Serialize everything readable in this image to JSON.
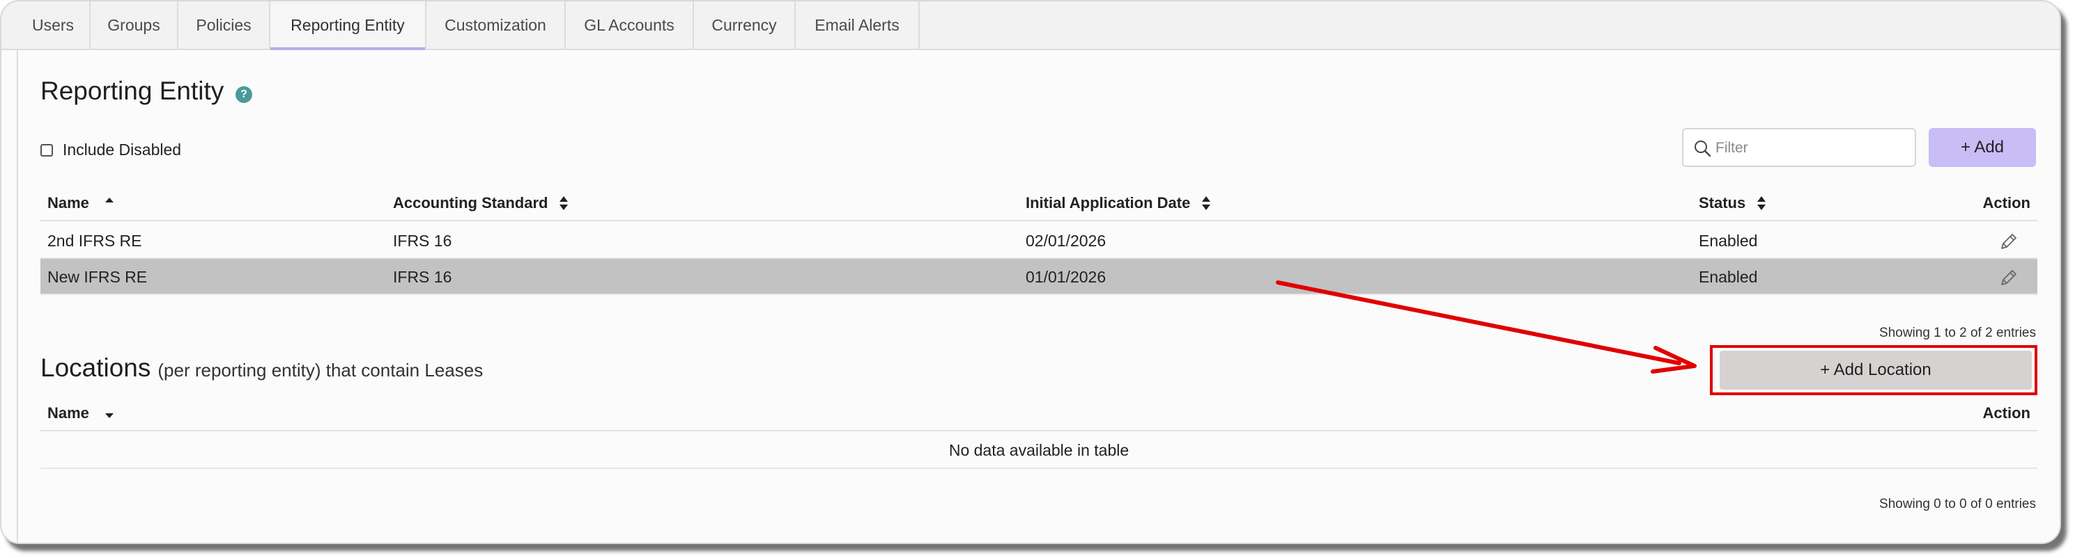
{
  "tabs": [
    {
      "label": "Users"
    },
    {
      "label": "Groups"
    },
    {
      "label": "Policies"
    },
    {
      "label": "Reporting Entity"
    },
    {
      "label": "Customization"
    },
    {
      "label": "GL Accounts"
    },
    {
      "label": "Currency"
    },
    {
      "label": "Email Alerts"
    }
  ],
  "active_tab": "Reporting Entity",
  "page": {
    "title": "Reporting Entity",
    "help_icon": "?"
  },
  "include_disabled": {
    "label": "Include Disabled",
    "checked": false
  },
  "filter": {
    "placeholder": "Filter",
    "value": ""
  },
  "add_button": {
    "label": "+ Add"
  },
  "reporting_table": {
    "columns": [
      {
        "label": "Name",
        "sort": "ascending"
      },
      {
        "label": "Accounting Standard",
        "sort": "none"
      },
      {
        "label": "Initial Application Date",
        "sort": "none"
      },
      {
        "label": "Status",
        "sort": "none"
      },
      {
        "label": "Action",
        "sort": "none"
      }
    ],
    "rows": [
      {
        "name": "2nd IFRS RE",
        "standard": "IFRS 16",
        "date": "02/01/2026",
        "status": "Enabled",
        "action_icon": "pencil-icon"
      },
      {
        "name": "New IFRS RE",
        "standard": "IFRS 16",
        "date": "01/01/2026",
        "status": "Enabled",
        "action_icon": "pencil-icon"
      }
    ],
    "info": "Showing 1 to 2 of 2 entries"
  },
  "locations": {
    "title": "Locations",
    "subtitle": "(per reporting entity) that contain Leases",
    "add_button_label": "+ Add Location",
    "columns": [
      {
        "label": "Name",
        "sort": "descending"
      },
      {
        "label": "Action"
      }
    ],
    "empty_text": "No data available in table",
    "info": "Showing 0 to 0 of 0 entries"
  },
  "colors": {
    "accent": "#c8bdf5",
    "tab_underline": "#b9a8f0",
    "annotation_red": "#e00000",
    "help_icon": "#4a9a9a",
    "highlight_row": "#c2c2c2"
  }
}
